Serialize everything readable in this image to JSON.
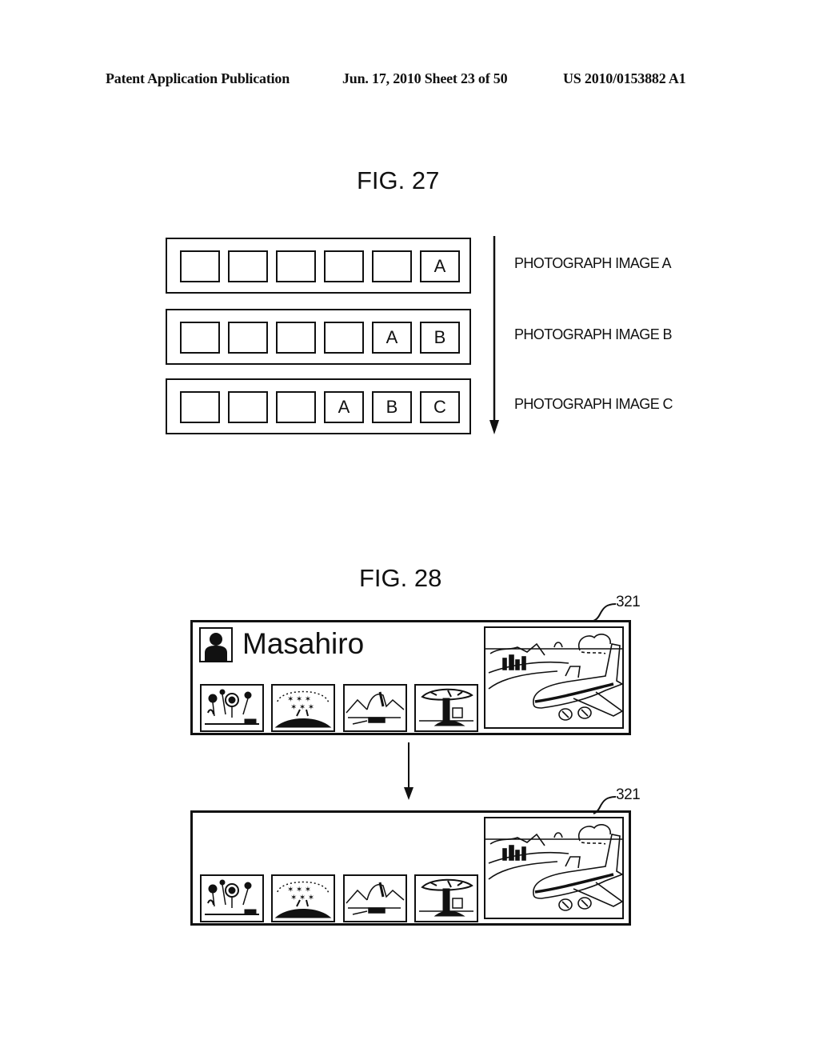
{
  "header": {
    "publication": "Patent Application Publication",
    "date_sheet": "Jun. 17, 2010  Sheet 23 of 50",
    "patent_number": "US 2010/0153882 A1"
  },
  "fig27": {
    "title": "FIG. 27",
    "rows": [
      {
        "cells": [
          "",
          "",
          "",
          "",
          "",
          "A"
        ],
        "label": "PHOTOGRAPH IMAGE A"
      },
      {
        "cells": [
          "",
          "",
          "",
          "",
          "A",
          "B"
        ],
        "label": "PHOTOGRAPH IMAGE B"
      },
      {
        "cells": [
          "",
          "",
          "",
          "A",
          "B",
          "C"
        ],
        "label": "PHOTOGRAPH IMAGE C"
      }
    ],
    "arrow": "down-arrow"
  },
  "fig28": {
    "title": "FIG. 28",
    "panels": [
      {
        "reference": "321",
        "user_name": "Masahiro",
        "avatar_icon": "person-silhouette-icon",
        "thumbnails": [
          "flowers-thumbnail",
          "cherry-blossom-thumbnail",
          "mountain-thumbnail",
          "tree-thumbnail"
        ],
        "featured_image": "airplane-coast-image"
      },
      {
        "reference": "321",
        "user_name": "",
        "thumbnails": [
          "flowers-thumbnail",
          "cherry-blossom-thumbnail",
          "mountain-thumbnail",
          "tree-thumbnail"
        ],
        "featured_image": "airplane-coast-image"
      }
    ]
  }
}
